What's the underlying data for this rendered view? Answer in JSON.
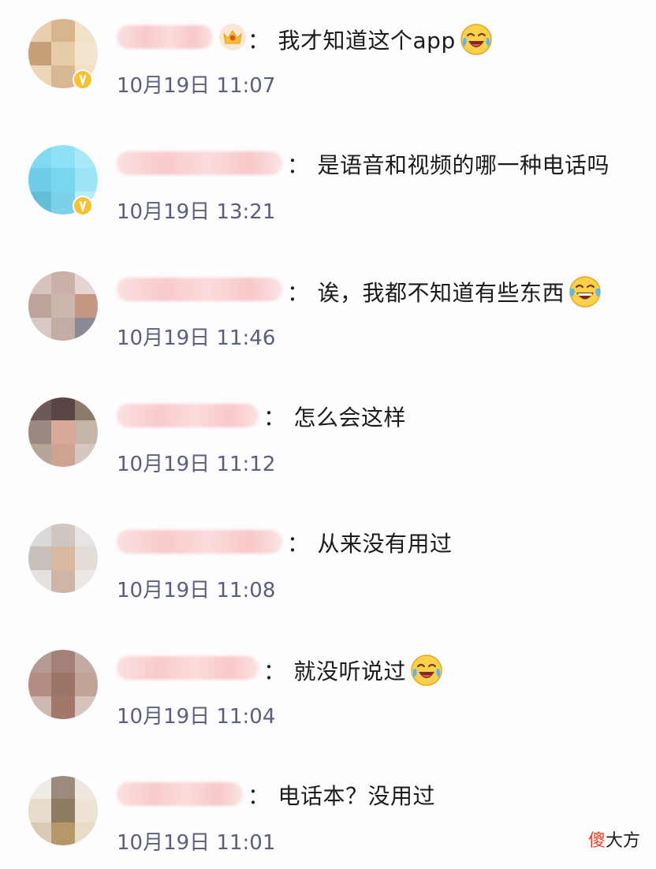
{
  "comments": [
    {
      "text": "我才知道这个app",
      "time": "10月19日 11:07",
      "emoji": "laughing-crying-emoji",
      "has_crown": true,
      "has_badge": true
    },
    {
      "text": "是语音和视频的哪一种电话吗",
      "time": "10月19日 13:21",
      "emoji": "",
      "has_crown": false,
      "has_badge": true
    },
    {
      "text": "诶，我都不知道有些东西",
      "time": "10月19日 11:46",
      "emoji": "tears-of-joy-emoji",
      "has_crown": false,
      "has_badge": false
    },
    {
      "text": "怎么会这样",
      "time": "10月19日 11:12",
      "emoji": "",
      "has_crown": false,
      "has_badge": false
    },
    {
      "text": "从来没有用过",
      "time": "10月19日 11:08",
      "emoji": "",
      "has_crown": false,
      "has_badge": false
    },
    {
      "text": "就没听说过",
      "time": "10月19日 11:04",
      "emoji": "laughing-crying-emoji",
      "has_crown": false,
      "has_badge": false
    },
    {
      "text": "电话本？没用过",
      "time": "10月19日 11:01",
      "emoji": "",
      "has_crown": false,
      "has_badge": false
    }
  ],
  "colon": "：",
  "watermark": {
    "accent_char": "傻",
    "rest": "大方"
  },
  "colors": {
    "background": "#fdfcfe",
    "timestamp": "#5a5f7a",
    "text": "#1b1b1b",
    "name_blur": "#f9caca",
    "watermark_accent": "#e8402b",
    "badge": "#f6c233"
  }
}
